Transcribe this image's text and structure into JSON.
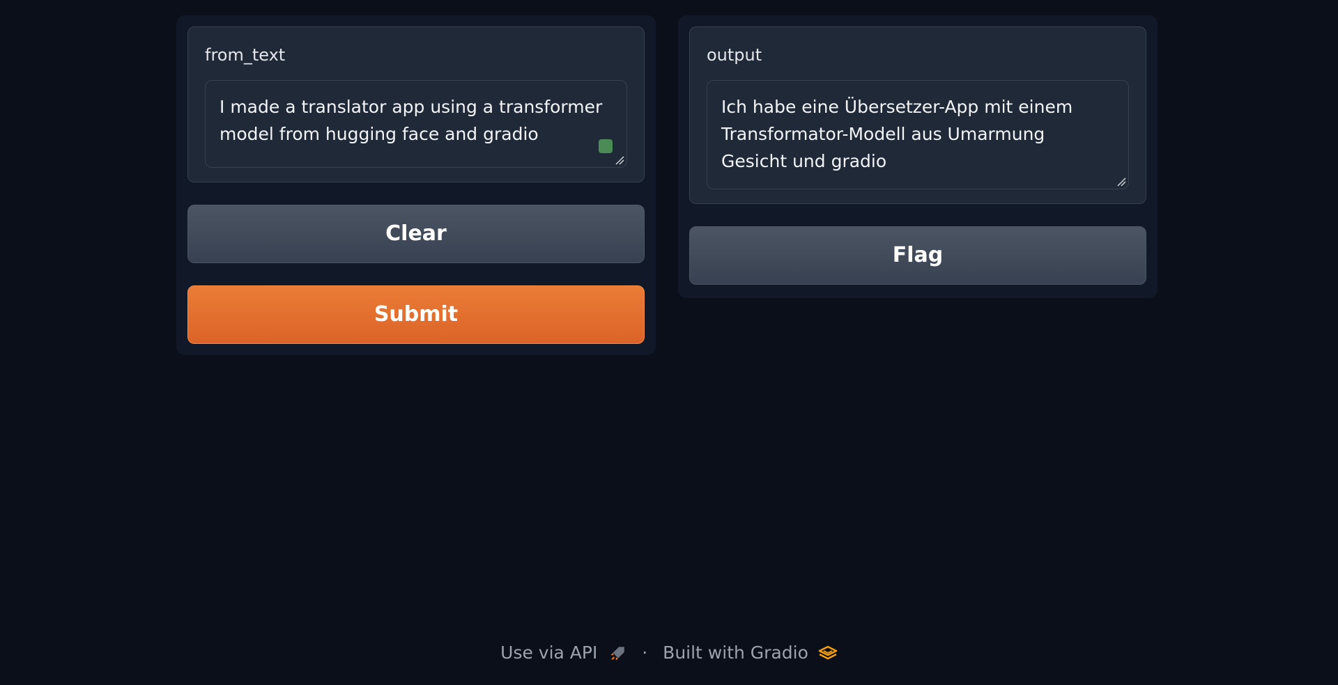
{
  "input": {
    "label": "from_text",
    "value": "I made a translator app using a transformer model from hugging face and gradio"
  },
  "buttons": {
    "clear": "Clear",
    "submit": "Submit",
    "flag": "Flag"
  },
  "output": {
    "label": "output",
    "value": "Ich habe eine Übersetzer-App mit einem Transformator-Modell aus Umarmung Gesicht und gradio"
  },
  "footer": {
    "api_link": "Use via API",
    "separator": "·",
    "built_with": "Built with Gradio"
  },
  "icons": {
    "api": "rocket-icon",
    "gradio": "gradio-logo-icon"
  },
  "colors": {
    "background": "#0b0f19",
    "panel": "#111827",
    "block": "#1f2937",
    "primary": "#ea7c36",
    "secondary": "#4b5563",
    "grammar_indicator": "#4b8b55"
  }
}
